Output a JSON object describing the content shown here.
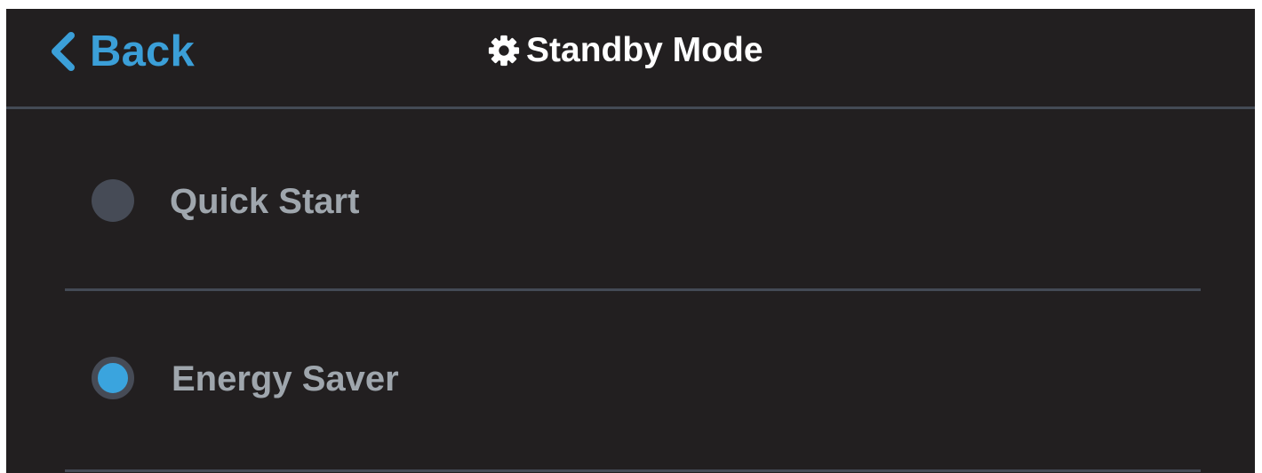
{
  "header": {
    "back_label": "Back",
    "title": "Standby Mode",
    "back_icon": "chevron-left-icon",
    "title_icon": "gear-icon"
  },
  "options": [
    {
      "label": "Quick Start",
      "selected": false
    },
    {
      "label": "Energy Saver",
      "selected": true
    }
  ],
  "colors": {
    "background": "#221f20",
    "accent": "#3b9fd8",
    "divider": "#444a55",
    "option_text": "#9fa6ad",
    "title_text": "#ffffff"
  }
}
